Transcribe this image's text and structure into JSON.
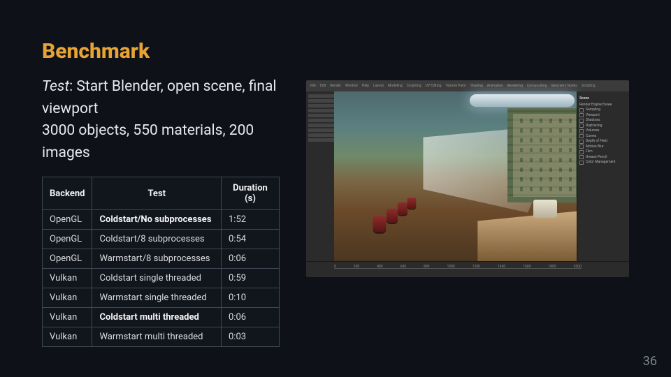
{
  "title": "Benchmark",
  "description": {
    "label": "Test",
    "line1": ": Start Blender, open scene, final viewport",
    "line2": "3000 objects, 550 materials, 200 images"
  },
  "table": {
    "headers": [
      "Backend",
      "Test",
      "Duration (s)"
    ],
    "rows": [
      {
        "backend": "OpenGL",
        "test": "Coldstart/No subprocesses",
        "duration": "1:52",
        "bold": true
      },
      {
        "backend": "OpenGL",
        "test": "Coldstart/8 subprocesses",
        "duration": "0:54",
        "bold": false
      },
      {
        "backend": "OpenGL",
        "test": "Warmstart/8 subprocesses",
        "duration": "0:06",
        "bold": false
      },
      {
        "backend": "Vulkan",
        "test": "Coldstart single threaded",
        "duration": "0:59",
        "bold": false
      },
      {
        "backend": "Vulkan",
        "test": "Warmstart single threaded",
        "duration": "0:10",
        "bold": false
      },
      {
        "backend": "Vulkan",
        "test": "Coldstart multi threaded",
        "duration": "0:06",
        "bold": true
      },
      {
        "backend": "Vulkan",
        "test": "Warmstart multi threaded",
        "duration": "0:03",
        "bold": false
      }
    ]
  },
  "screenshot": {
    "app": "Blender",
    "topbar_items": [
      "File",
      "Edit",
      "Render",
      "Window",
      "Help",
      "Layout",
      "Modeling",
      "Sculpting",
      "UV Editing",
      "Texture Paint",
      "Shading",
      "Animation",
      "Rendering",
      "Compositing",
      "Geometry Nodes",
      "Scripting"
    ],
    "right_panel": {
      "scene_header": "Scene",
      "render_engine_label": "Render Engine",
      "render_engine_value": "Eevee",
      "sampling": "Sampling",
      "viewport": "Viewport",
      "shadows": "Shadows",
      "raytracing": "Raytracing",
      "volumes": "Volumes",
      "curves": "Curves",
      "depth_of_field": "Depth of Field",
      "motion_blur": "Motion Blur",
      "film": "Film",
      "grease_pencil": "Grease Pencil",
      "color_management": "Color Management"
    },
    "timeline_ticks": [
      "0",
      "200",
      "400",
      "600",
      "800",
      "1000",
      "1200",
      "1400",
      "1600",
      "1800",
      "2000"
    ]
  },
  "page_number": "36"
}
